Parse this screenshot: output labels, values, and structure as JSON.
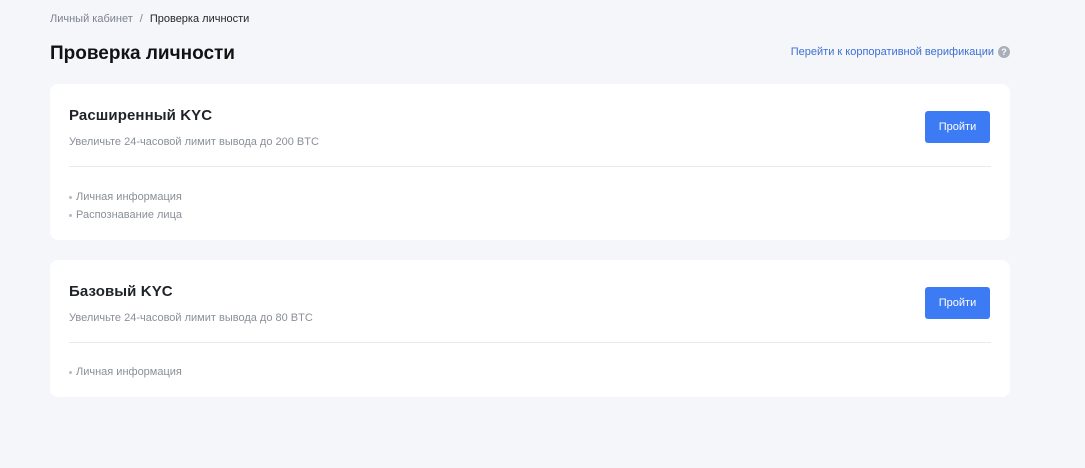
{
  "breadcrumb": {
    "parent": "Личный кабинет",
    "separator": "/",
    "current": "Проверка личности"
  },
  "header": {
    "title": "Проверка личности",
    "corporate_link": "Перейти к корпоративной верификации",
    "help_icon": "?"
  },
  "cards": [
    {
      "title": "Расширенный KYC",
      "subtitle": "Увеличьте 24-часовой лимит вывода до 200 BTC",
      "button": "Пройти",
      "requirements": [
        "Личная информация",
        "Распознавание лица"
      ]
    },
    {
      "title": "Базовый KYC",
      "subtitle": "Увеличьте 24-часовой лимит вывода до 80 BTC",
      "button": "Пройти",
      "requirements": [
        "Личная информация"
      ]
    }
  ],
  "colors": {
    "background": "#f5f6fa",
    "card": "#ffffff",
    "primary_button": "#3d7bf5",
    "link": "#3b6fd4",
    "muted_text": "#8a8f99"
  }
}
